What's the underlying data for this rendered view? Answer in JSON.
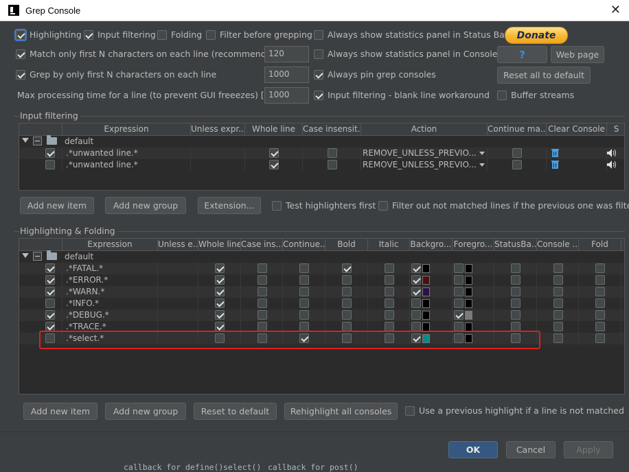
{
  "window": {
    "title": "Grep Console"
  },
  "settings": {
    "highlighting": "Highlighting",
    "input_filtering": "Input filtering",
    "folding": "Folding",
    "filter_before_grepping": "Filter before grepping",
    "stats_status_bar": "Always show statistics panel in Status Bar",
    "match_first_n": "Match only first N characters on each line (recommended)",
    "match_first_n_value": "120",
    "stats_console": "Always show statistics panel in Console",
    "grep_first_n": "Grep by only first N characters on each line",
    "grep_first_n_value": "1000",
    "pin_consoles": "Always pin grep consoles",
    "max_time": "Max processing time for a line (to prevent GUI freeezes) [ms]",
    "max_time_value": "1000",
    "blank_line_workaround": "Input filtering - blank line workaround",
    "buffer_streams": "Buffer streams",
    "donate": "Donate",
    "help": "?",
    "web_page": "Web page",
    "reset_all": "Reset all to default"
  },
  "input_filtering": {
    "title": "Input filtering",
    "columns": [
      "",
      "Expression",
      "Unless expr...",
      "Whole line",
      "Case insensit...",
      "Action",
      "Continue ma...",
      "Clear Console",
      "S"
    ],
    "group": "default",
    "rows": [
      {
        "expression": ".*unwanted line.*",
        "action": "REMOVE_UNLESS_PREVIO..."
      },
      {
        "expression": ".*unwanted line.*",
        "action": "REMOVE_UNLESS_PREVIO..."
      }
    ],
    "buttons": {
      "add_item": "Add new item",
      "add_group": "Add new group",
      "extension": "Extension...",
      "test_first": "Test highlighters first",
      "filter_out": "Filter out not matched lines if the previous one was filtered"
    }
  },
  "highlighting": {
    "title": "Highlighting & Folding",
    "columns": [
      "",
      "Expression",
      "Unless e...",
      "Whole line",
      "Case ins...",
      "Continue...",
      "Bold",
      "Italic",
      "Backgro...",
      "Foregro...",
      "StatusBa...",
      "Console ...",
      "Fold"
    ],
    "group": "default",
    "rows": [
      {
        "expression": ".*FATAL.*",
        "bg": "#000000",
        "fg": "#000000"
      },
      {
        "expression": ".*ERROR.*",
        "bg": "#4a0f0f",
        "fg": "#000000"
      },
      {
        "expression": ".*WARN.*",
        "bg": "#2d0f4a",
        "fg": "#000000"
      },
      {
        "expression": ".*INFO.*",
        "bg": "#000000",
        "fg": "#000000"
      },
      {
        "expression": ".*DEBUG.*",
        "bg": "#000000",
        "fg": "#7a7a7a"
      },
      {
        "expression": ".*TRACE.*",
        "bg": "#000000",
        "fg": "#000000"
      },
      {
        "expression": ".*select.*",
        "bg": "#0a8c84",
        "fg": "#000000"
      }
    ],
    "buttons": {
      "add_item": "Add new item",
      "add_group": "Add new group",
      "reset": "Reset to default",
      "rehighlight": "Rehighlight all consoles",
      "use_previous": "Use a previous highlight if a line is not matched"
    }
  },
  "dialog": {
    "ok": "OK",
    "cancel": "Cancel",
    "apply": "Apply"
  },
  "background_code": {
    "a": "callback for define()",
    "b": "select()",
    "c": "callback for post()"
  },
  "colors": {
    "accent": "#365880",
    "highlight_border": "#e0201c"
  }
}
